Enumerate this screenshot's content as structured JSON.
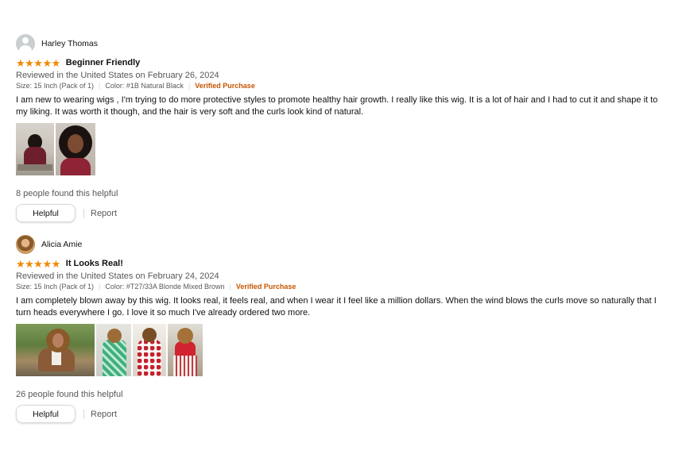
{
  "reviews": [
    {
      "reviewer": "Harley Thomas",
      "stars": "★★★★★",
      "title": "Beginner Friendly",
      "date": "Reviewed in the United States on February 26, 2024",
      "size": "Size: 15 Inch (Pack of 1)",
      "color": "Color: #1B Natural Black",
      "verified": "Verified Purchase",
      "body": "I am new to wearing wigs , I'm trying to do more protective styles to promote healthy hair growth. I really like this wig. It is a lot of hair and I had to cut it and shape it to my liking. It was worth it though, and the hair is very soft and the curls look kind of natural.",
      "helpful_count": "8 people found this helpful",
      "helpful_label": "Helpful",
      "report_label": "Report"
    },
    {
      "reviewer": "Alicia Amie",
      "stars": "★★★★★",
      "title": "It Looks Real!",
      "date": "Reviewed in the United States on February 24, 2024",
      "size": "Size: 15 Inch (Pack of 1)",
      "color": "Color: #T27/33A Blonde Mixed Brown",
      "verified": "Verified Purchase",
      "body": "I am completely blown away by this wig. It looks real, it feels real, and when I wear it I feel like a million dollars. When the wind blows the curls move so naturally that I turn heads everywhere I go. I love it so much I've already ordered two more.",
      "helpful_count": "26 people found this helpful",
      "helpful_label": "Helpful",
      "report_label": "Report"
    }
  ],
  "colors": {
    "stars": "#f08804",
    "verified": "#c45500",
    "muted_text": "#565959"
  }
}
